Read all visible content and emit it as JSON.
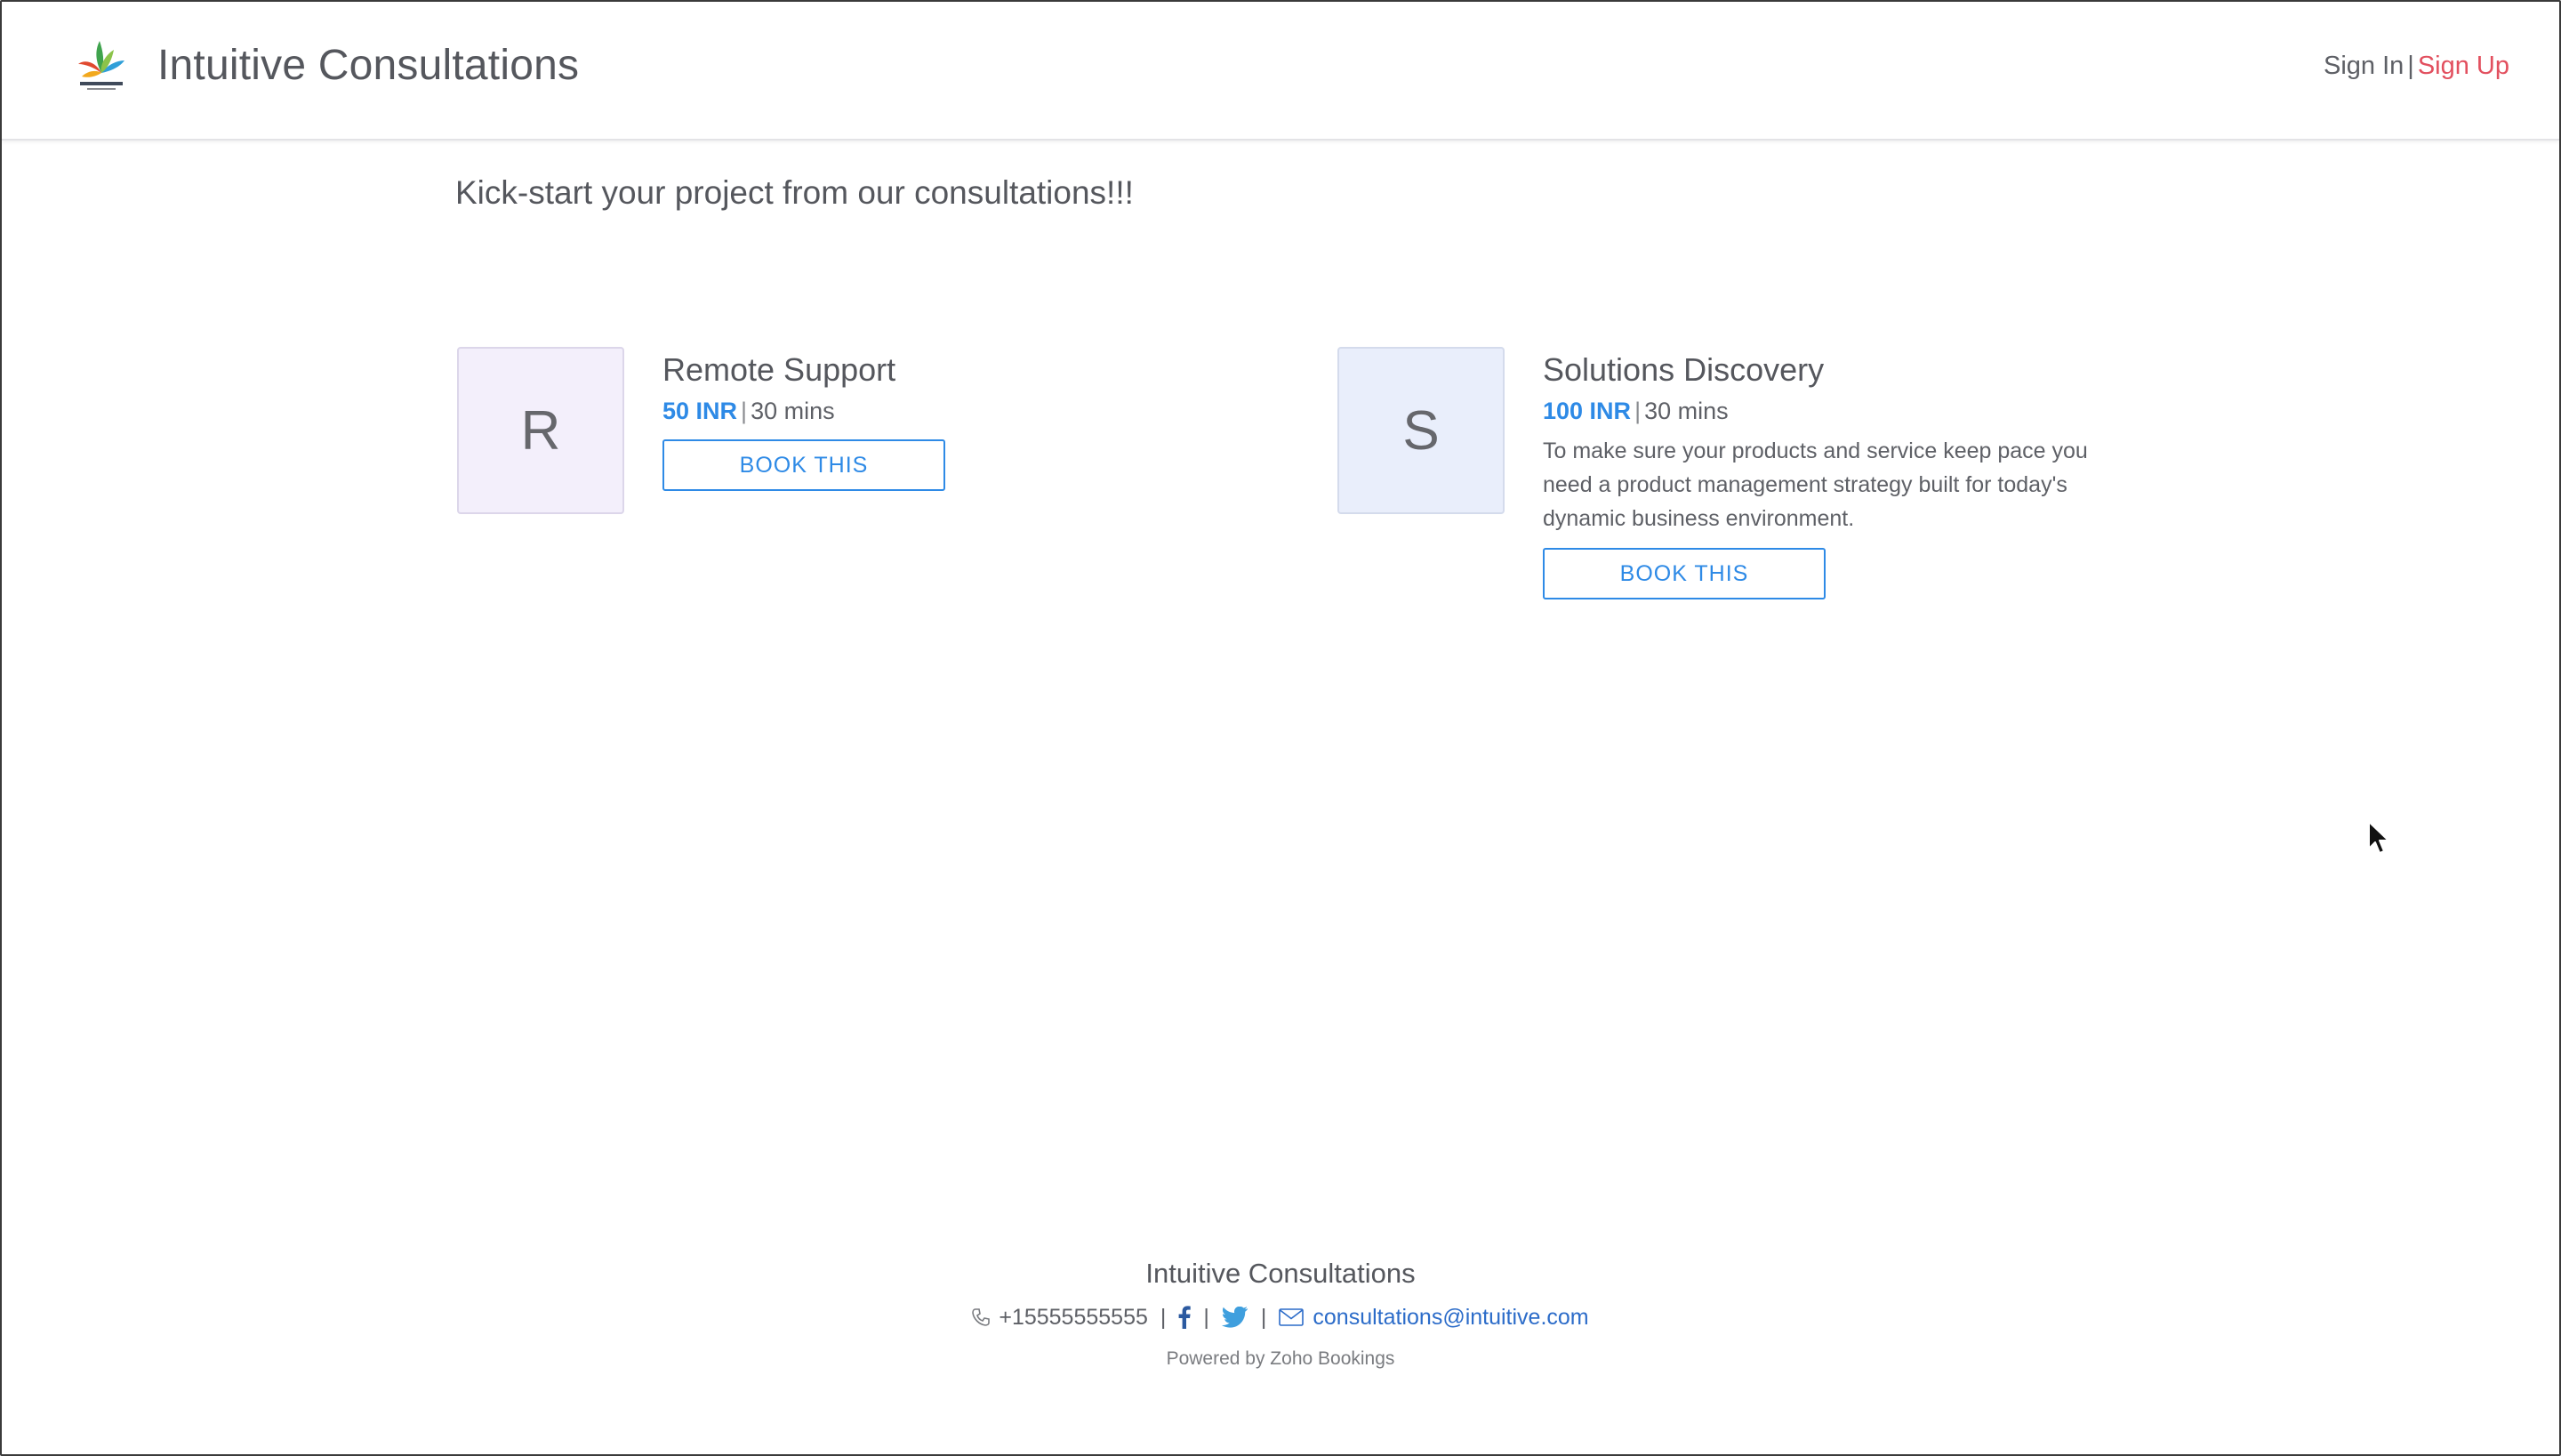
{
  "header": {
    "brand": "Intuitive Consultations",
    "sign_in": "Sign In",
    "separator": "|",
    "sign_up": "Sign Up"
  },
  "main": {
    "tagline": "Kick-start your project from our consultations!!!",
    "services": [
      {
        "initial": "R",
        "title": "Remote Support",
        "price": "50 INR",
        "duration": "30 mins",
        "description": "",
        "button": "BOOK THIS"
      },
      {
        "initial": "S",
        "title": "Solutions Discovery",
        "price": "100 INR",
        "duration": "30 mins",
        "description": "To make sure your products and service keep pace you need a product management strategy built for today's dynamic business environment.",
        "button": "BOOK THIS"
      }
    ]
  },
  "footer": {
    "name": "Intuitive Consultations",
    "phone": "+15555555555",
    "email": "consultations@intuitive.com",
    "powered_by": "Powered by Zoho Bookings"
  },
  "colors": {
    "accent": "#2e8ae6",
    "signup": "#e2505f",
    "text": "#55575d"
  },
  "icons": [
    "brand-logo-icon",
    "phone-icon",
    "facebook-icon",
    "twitter-icon",
    "mail-icon",
    "mouse-cursor-icon"
  ]
}
